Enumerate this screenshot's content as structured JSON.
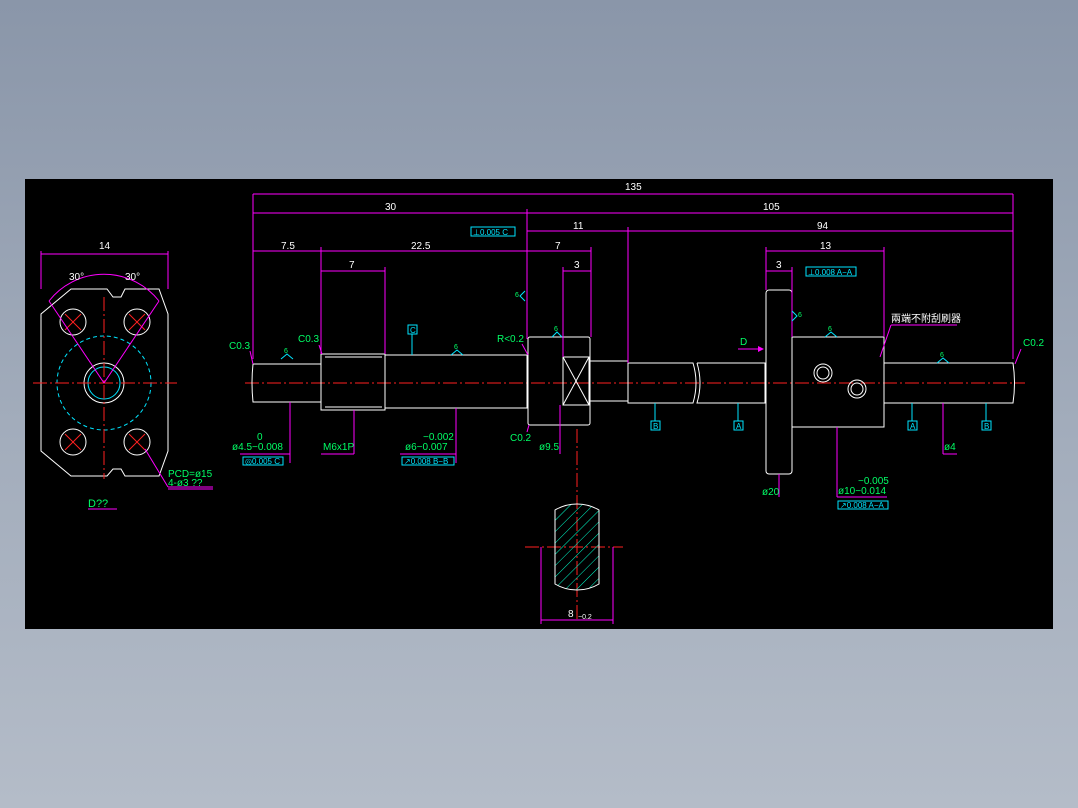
{
  "dims": {
    "overall": "135",
    "left_30": "30",
    "right_105": "105",
    "seg_7_5": "7.5",
    "seg_22_5": "22.5",
    "seg_7_a": "7",
    "seg_7_b": "7",
    "seg_11": "11",
    "seg_94": "94",
    "seg_13": "13",
    "seg_3_a": "3",
    "seg_3_b": "3",
    "flange_14": "14",
    "angle_l": "30°",
    "angle_r": "30°",
    "section_w": "8"
  },
  "notes": {
    "c03_left": "C0.3",
    "c03_step": "C0.3",
    "r02": "R<0.2",
    "c02_right": "C0.2",
    "c02_collar": "C0.2",
    "dia45_up": "0",
    "dia45": "ø4.5−0.008",
    "m6": "M6x1P",
    "dia6_up": "−0.002",
    "dia6": "ø6−0.007",
    "dia95": "ø9.5",
    "dia20": "ø20",
    "dia10_up": "−0.005",
    "dia10": "ø10−0.014",
    "dia4": "ø4",
    "pcd": "PCD=ø15",
    "holes": "4-ø3 ??",
    "view_d": "D??",
    "arrow_d": "D",
    "cjk_note": "兩端不附刮刷器",
    "section_tol": "−0.2",
    "ra_1": "6",
    "ra_2": "6",
    "ra_3": "6",
    "ra_4": "6",
    "ra_5": "6",
    "ra_6": "6",
    "ra_7": "6"
  },
  "tol_boxes": {
    "top_left": "⊥0.005 C",
    "nut_top": "⊥0.008 A−A",
    "dia45_box": "◎0.005 C",
    "dia6_box": "↗0.008 B−B",
    "dia10_box": "↗0.008 A−A"
  },
  "datums": {
    "c": "C",
    "b1": "B",
    "a1": "A",
    "a2": "A",
    "b2": "B"
  },
  "colors": {
    "background": "#000000",
    "dimension": "#ff00ff",
    "outline": "#ffffff",
    "centerline": "#ff2020",
    "annotation": "#00ff66",
    "datum": "#00e5ff",
    "hatch": "#00ffcc"
  }
}
